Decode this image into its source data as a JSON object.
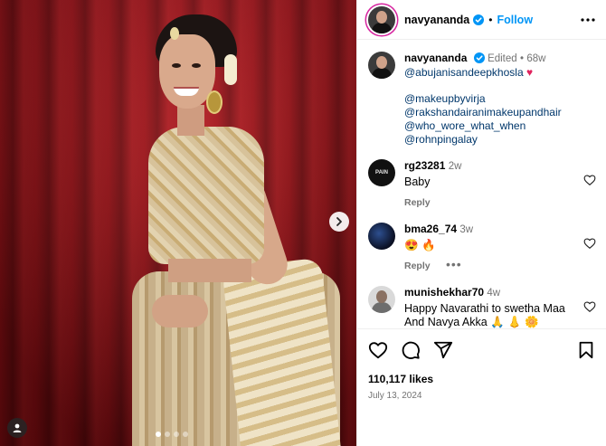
{
  "post": {
    "username": "navyananda",
    "follow_label": "Follow",
    "separator": "•"
  },
  "caption": {
    "username": "navyananda",
    "edited": "Edited",
    "dot": "•",
    "age": "68w",
    "line1": "@abujanisandeepkhosla",
    "heart": "♥",
    "mentions": [
      "@makeupbyvirja",
      "@rakshandairanimakeupandhair",
      "@who_wore_what_when",
      "@rohnpingalay"
    ]
  },
  "comments": [
    {
      "username": "rg23281",
      "age": "2w",
      "text": "Baby",
      "reply": "Reply",
      "avatar_text": "PAIN"
    },
    {
      "username": "bma26_74",
      "age": "3w",
      "text": "😍 🔥",
      "reply": "Reply",
      "more": "•••"
    },
    {
      "username": "munishekhar70",
      "age": "4w",
      "text": "Happy Navarathi to swetha Maa And Navya Akka 🙏 👃 🌼"
    }
  ],
  "stats": {
    "likes": "110,117 likes",
    "date": "July 13, 2024"
  },
  "colors": {
    "accent": "#0095f6",
    "link": "#00376b",
    "muted": "#737373",
    "curtain": "#9a1117"
  },
  "icons": {
    "next": "chevron-right-icon",
    "tag": "user-tag-icon",
    "verified": "verified-badge-icon",
    "more": "more-options-icon",
    "like": "heart-icon",
    "comment": "comment-icon",
    "share": "share-icon",
    "save": "bookmark-icon"
  }
}
